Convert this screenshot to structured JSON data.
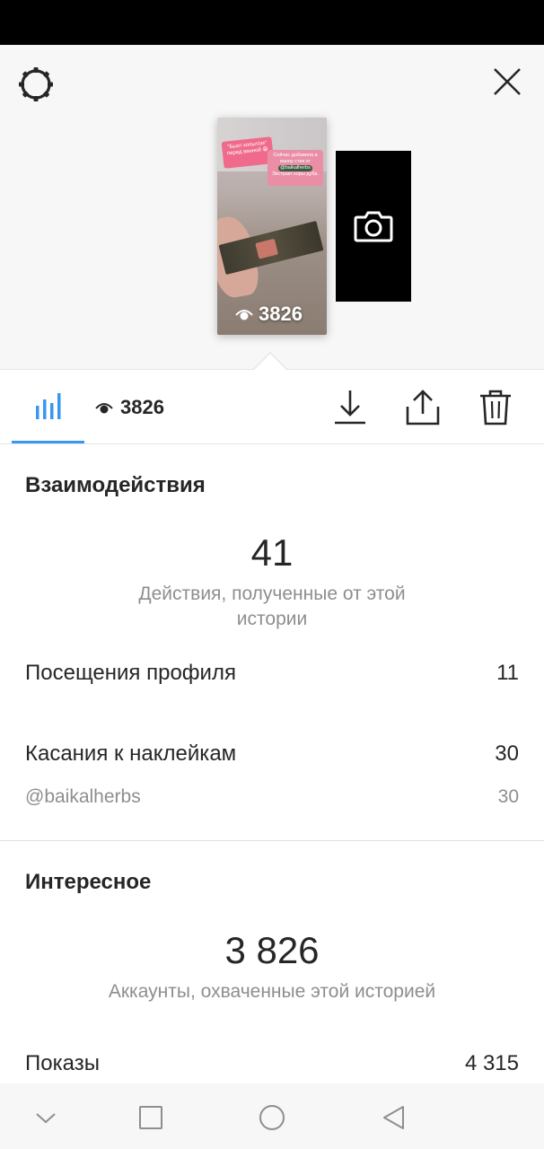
{
  "story": {
    "view_count": "3826",
    "sticker_headline": "\"Бьют копытом\" перед ванной 😁",
    "sticker_text": "Сейчас добавила в ванну стик от",
    "sticker_mention": "@baikalherbs",
    "sticker_tail": "Экстракт коры дуба."
  },
  "toolbar": {
    "viewer_count": "3826"
  },
  "interactions": {
    "title": "Взаимодействия",
    "total_value": "41",
    "total_caption": "Действия, полученные от этой истории",
    "rows": [
      {
        "label": "Посещения профиля",
        "value": "11"
      },
      {
        "label": "Касания к наклейкам",
        "value": "30"
      }
    ],
    "sub_row": {
      "label": "@baikalherbs",
      "value": "30"
    }
  },
  "discovery": {
    "title": "Интересное",
    "total_value": "3 826",
    "total_caption": "Аккаунты, охваченные этой историей",
    "rows": [
      {
        "label": "Показы",
        "value": "4 315"
      }
    ]
  },
  "colors": {
    "accent": "#3897f0",
    "text_primary": "#262626",
    "text_secondary": "#8e8e8e"
  },
  "icons": [
    "settings-gear-icon",
    "close-icon",
    "camera-icon",
    "eye-icon",
    "bar-chart-icon",
    "download-icon",
    "share-icon",
    "trash-icon",
    "nav-back-chevron-icon",
    "nav-recents-icon",
    "nav-home-icon",
    "nav-back-triangle-icon"
  ]
}
